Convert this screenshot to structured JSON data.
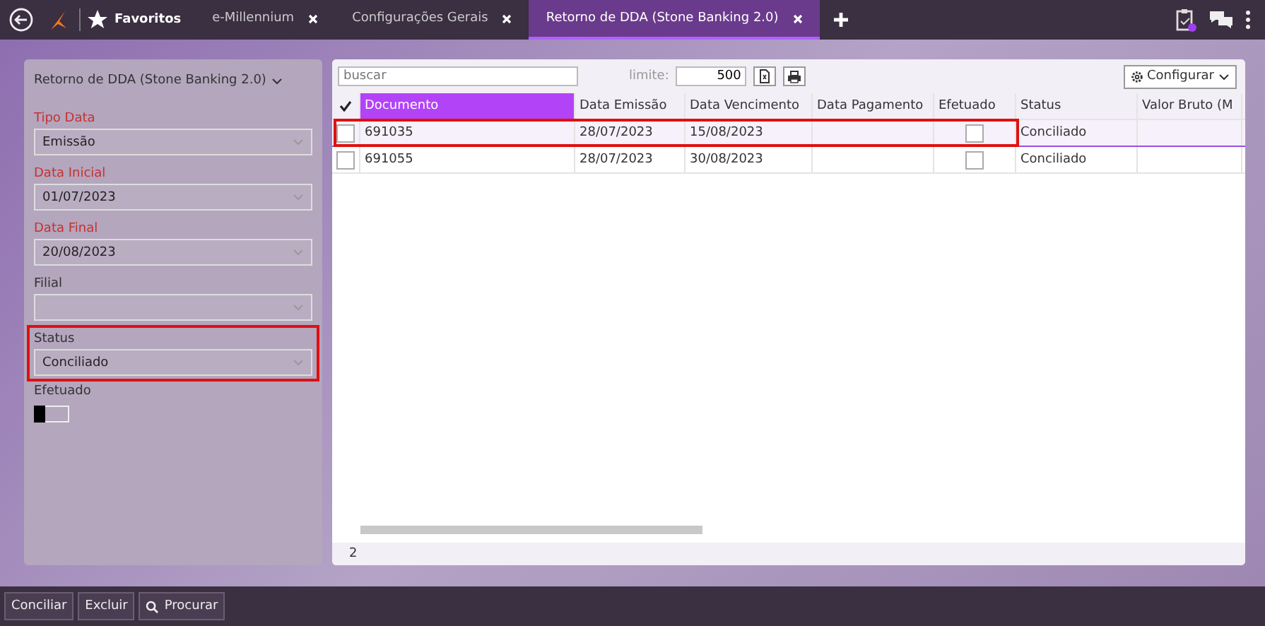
{
  "top_bar": {
    "favorites": "Favoritos",
    "tabs": [
      {
        "label": "e-Millennium",
        "selected": false
      },
      {
        "label": "Configurações Gerais",
        "selected": false
      },
      {
        "label": "Retorno de DDA (Stone Banking 2.0)",
        "selected": true
      }
    ],
    "notification": true
  },
  "filters": {
    "title": "Retorno de DDA (Stone Banking 2.0)",
    "fields": [
      {
        "label": "Tipo Data",
        "value": "Emissão",
        "required": true,
        "highlighted": false
      },
      {
        "label": "Data Inicial",
        "value": "01/07/2023",
        "required": true,
        "highlighted": false
      },
      {
        "label": "Data Final",
        "value": "20/08/2023",
        "required": true,
        "highlighted": false
      },
      {
        "label": "Filial",
        "required": false,
        "highlighted": false
      },
      {
        "label": "Status",
        "value": "Conciliado",
        "required": false,
        "highlighted": true
      }
    ],
    "toggle": {
      "label": "Efetuado",
      "on": false
    }
  },
  "grid": {
    "search": {
      "placeholder": "buscar"
    },
    "limit_label": "limite:",
    "limit": "500",
    "configure": "Configurar",
    "columns": [
      {
        "label": "Documento",
        "selected": true
      },
      {
        "label": "Data Emissão",
        "selected": false
      },
      {
        "label": "Data Vencimento",
        "selected": false
      },
      {
        "label": "Data Pagamento",
        "selected": false
      },
      {
        "label": "Efetuado",
        "selected": false
      },
      {
        "label": "Status",
        "selected": false
      },
      {
        "label": "Valor Bruto (M",
        "selected": false
      }
    ],
    "rows": [
      {
        "checked": false,
        "selected": true,
        "highlighted": true,
        "documento": "691035",
        "emissao": "28/07/2023",
        "vencimento": "15/08/2023",
        "efetuado": false,
        "status": "Conciliado"
      },
      {
        "checked": false,
        "selected": false,
        "highlighted": false,
        "documento": "691055",
        "emissao": "28/07/2023",
        "vencimento": "30/08/2023",
        "efetuado": false,
        "status": "Conciliado"
      }
    ],
    "count": "2"
  },
  "buttons": [
    "Conciliar",
    "Excluir",
    "Procurar"
  ]
}
